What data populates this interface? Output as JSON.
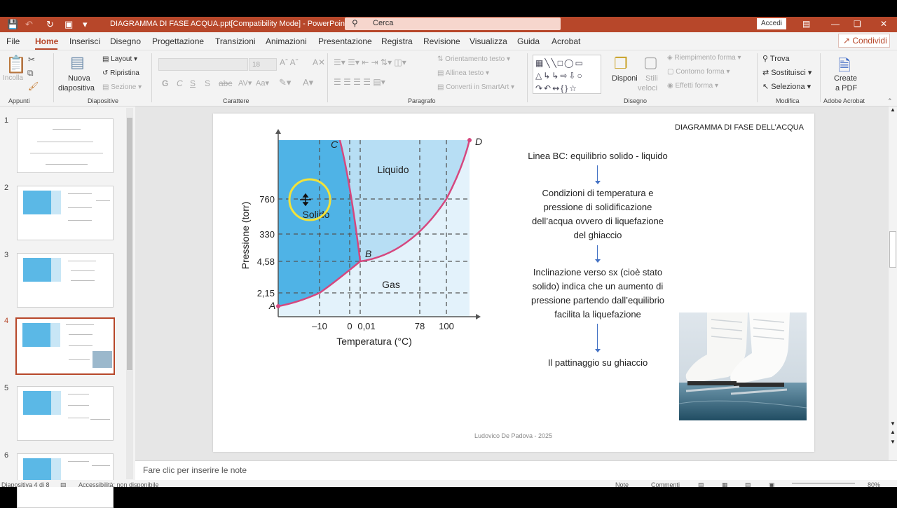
{
  "app": {
    "doc_title": "DIAGRAMMA DI FASE ACQUA.ppt[Compatibility Mode]  -  PowerPoint",
    "search_placeholder": "Cerca",
    "signin_label": "Accedi",
    "accent_color": "#b7472a"
  },
  "tabs": [
    "File",
    "Home",
    "Inserisci",
    "Disegno",
    "Progettazione",
    "Transizioni",
    "Animazioni",
    "Presentazione",
    "Registra",
    "Revisione",
    "Visualizza",
    "Guida",
    "Acrobat"
  ],
  "share_label": "Condividi",
  "ribbon": {
    "paste": "Incolla",
    "new_slide_1": "Nuova",
    "new_slide_2": "diapositiva",
    "layout": "Layout",
    "reset": "Ripristina",
    "section": "Sezione",
    "font_size": "18",
    "text_direction": "Orientamento testo",
    "align_text": "Allinea testo",
    "smartart": "Converti in SmartArt",
    "arrange": "Disponi",
    "quick_styles_1": "Stili",
    "quick_styles_2": "veloci",
    "shape_fill": "Riempimento forma",
    "shape_outline": "Contorno forma",
    "shape_effects": "Effetti forma",
    "find": "Trova",
    "replace": "Sostituisci",
    "select": "Seleziona",
    "create_pdf_1": "Create",
    "create_pdf_2": "a PDF",
    "groups": {
      "clipboard": "Appunti",
      "slides": "Diapositive",
      "font": "Carattere",
      "paragraph": "Paragrafo",
      "drawing": "Disegno",
      "editing": "Modifica",
      "acrobat": "Adobe Acrobat"
    }
  },
  "thumbnails": {
    "numbers": [
      "1",
      "2",
      "3",
      "4",
      "5",
      "6"
    ],
    "selected": "4"
  },
  "slide": {
    "title": "DIAGRAMMA DI FASE DELL’ACQUA",
    "line_bc": "Linea BC: equilibrio solido - liquido",
    "conditions": "Condizioni di temperatura e pressione di solidificazione dell’acqua ovvero di liquefazione del ghiaccio",
    "inclination": "Inclinazione verso sx (cioè stato solido) indica che un aumento di pressione partendo dall’equilibrio facilita la liquefazione",
    "skating": "Il pattinaggio su ghiaccio",
    "footer": "Ludovico De Padova - 2025"
  },
  "chart_data": {
    "type": "line",
    "title": "",
    "xlabel": "Temperatura (°C)",
    "ylabel": "Pressione (torr)",
    "x_ticks": [
      "–10",
      "0",
      "0,01",
      "78",
      "100"
    ],
    "y_ticks": [
      "760",
      "330",
      "4,58",
      "2,15"
    ],
    "point_labels": [
      "A",
      "B",
      "C",
      "D"
    ],
    "regions": [
      "Solido",
      "Liquido",
      "Gas"
    ],
    "series": [
      {
        "points": [
          {
            "x": "A",
            "y": "A"
          },
          {
            "x": "–10",
            "y": "2,15"
          },
          {
            "x": "0,01",
            "y": "4,58"
          }
        ]
      },
      {
        "points": [
          {
            "x": "0,01",
            "y": "4,58"
          },
          {
            "x": "C",
            "y": "C"
          }
        ]
      },
      {
        "points": [
          {
            "x": "0,01",
            "y": "4,58"
          },
          {
            "x": "100",
            "y": "760"
          },
          {
            "x": "D",
            "y": "D"
          }
        ]
      }
    ],
    "colors": {
      "solid": "#4fb3e6",
      "liquid": "#b7def4",
      "gas": "#e3f2fb",
      "curve": "#d6477e"
    },
    "grid": "dashed"
  },
  "notes_placeholder": "Fare clic per inserire le note",
  "status": {
    "slide_counter": "Diapositiva 4 di 8",
    "accessibility": "Accessibilità: non disponibile",
    "notes": "Note",
    "comments": "Commenti",
    "zoom": "80%"
  }
}
